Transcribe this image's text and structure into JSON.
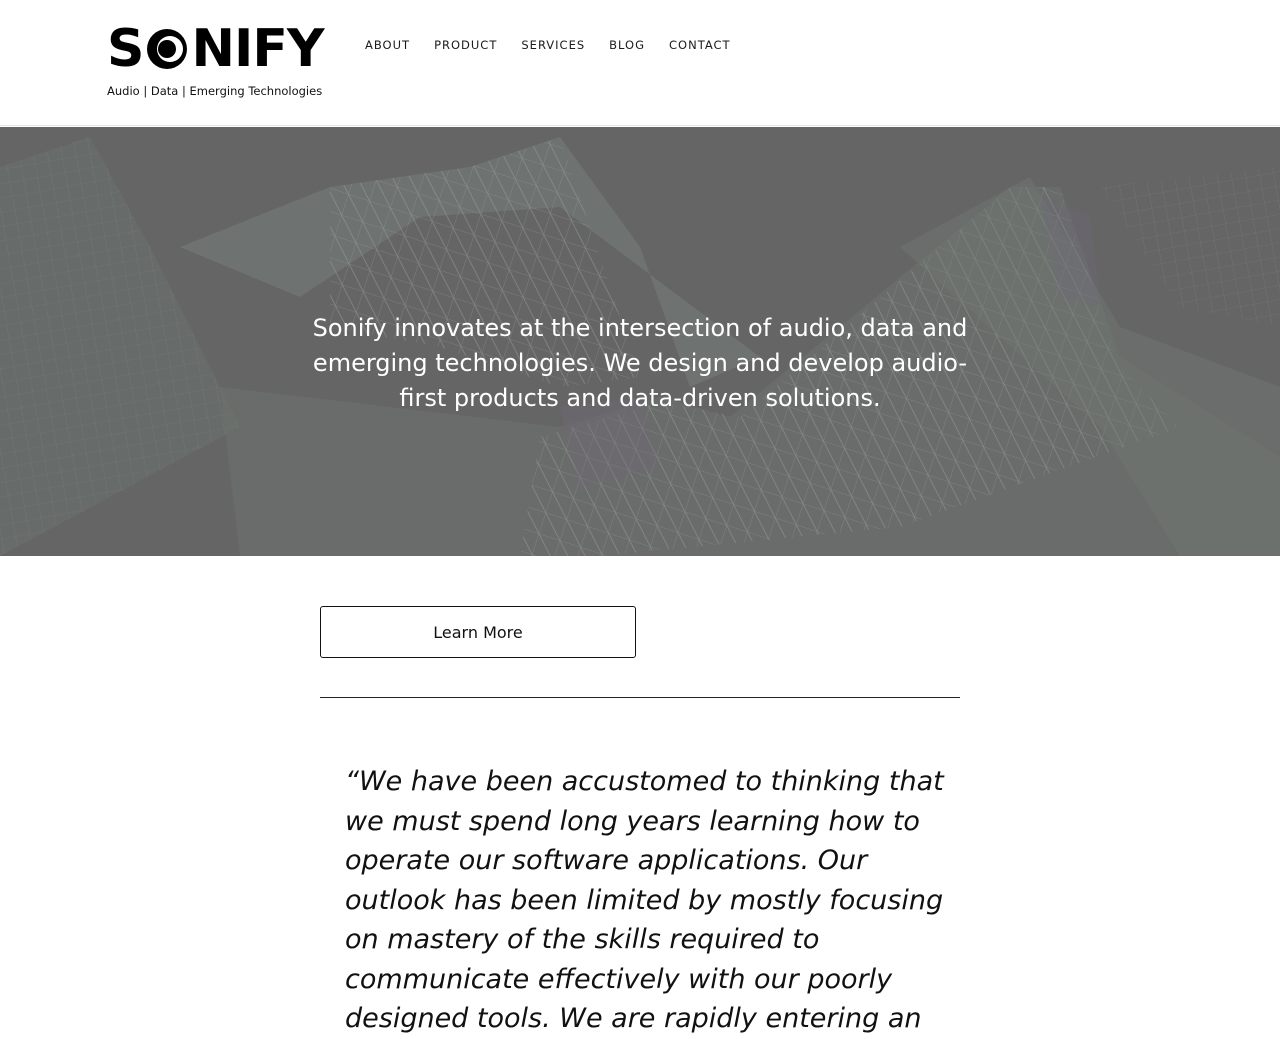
{
  "brand": {
    "logo_left": "S",
    "logo_right": "NIFY",
    "tagline": "Audio | Data | Emerging Technologies"
  },
  "nav": {
    "items": [
      {
        "label": "ABOUT"
      },
      {
        "label": "PRODUCT"
      },
      {
        "label": "SERVICES"
      },
      {
        "label": "BLOG"
      },
      {
        "label": "CONTACT"
      }
    ]
  },
  "hero": {
    "text": "Sonify innovates at the intersection of audio, data and emerging technologies. We design and develop audio-first products and data-driven solutions."
  },
  "cta": {
    "label": "Learn More"
  },
  "quote": {
    "text": "“We have been accustomed to thinking that we must spend long years learning how to operate our software applications. Our outlook has been limited by mostly focusing on mastery of the skills required to communicate effectively with our poorly designed tools. We are rapidly entering an"
  },
  "colors": {
    "hero_overlay": "#6a6a6a",
    "text": "#111111",
    "background": "#ffffff"
  }
}
